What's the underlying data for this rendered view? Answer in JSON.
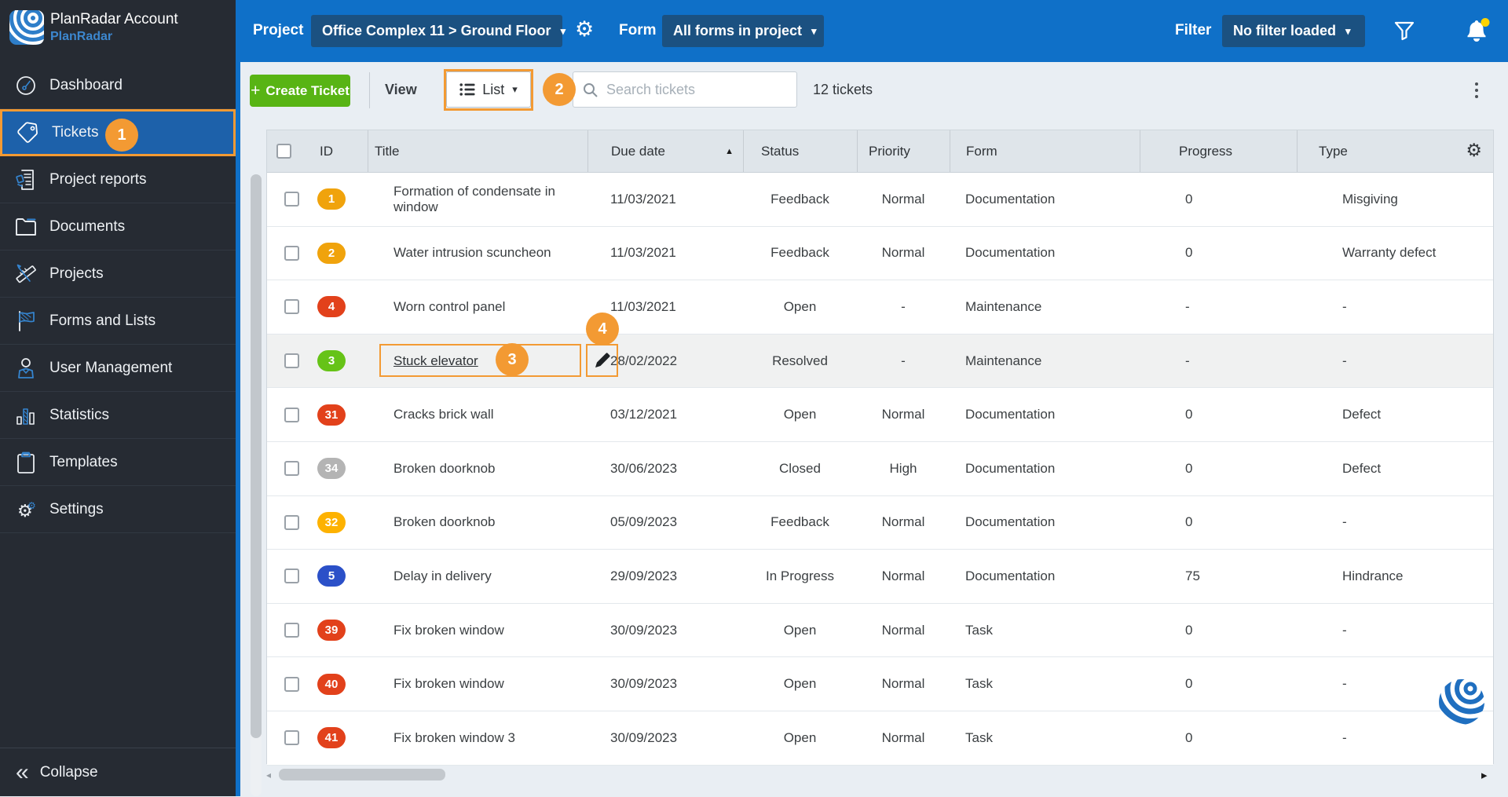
{
  "account": {
    "title": "PlanRadar Account",
    "subtitle": "PlanRadar"
  },
  "sidebar": {
    "items": [
      {
        "label": "Dashboard",
        "icon": "gauge-icon",
        "active": false
      },
      {
        "label": "Tickets",
        "icon": "tag-icon",
        "active": true,
        "annotation": "1"
      },
      {
        "label": "Project reports",
        "icon": "report-icon",
        "active": false
      },
      {
        "label": "Documents",
        "icon": "folder-icon",
        "active": false
      },
      {
        "label": "Projects",
        "icon": "ruler-pencil-icon",
        "active": false
      },
      {
        "label": "Forms and Lists",
        "icon": "flag-icon",
        "active": false
      },
      {
        "label": "User Management",
        "icon": "user-icon",
        "active": false
      },
      {
        "label": "Statistics",
        "icon": "bar-chart-icon",
        "active": false
      },
      {
        "label": "Templates",
        "icon": "clipboard-icon",
        "active": false
      },
      {
        "label": "Settings",
        "icon": "gears-icon",
        "active": false
      }
    ],
    "collapse_label": "Collapse"
  },
  "topbar": {
    "project_label": "Project",
    "project_value": "Office Complex 11 > Ground Floor",
    "form_label": "Form",
    "form_value": "All forms in project",
    "filter_label": "Filter",
    "filter_value": "No filter loaded"
  },
  "toolbar": {
    "create_plus": "+",
    "create_label": "Create Ticket",
    "view_label": "View",
    "view_mode": "List",
    "search_placeholder": "Search tickets",
    "ticket_count": "12 tickets"
  },
  "table": {
    "columns": [
      "ID",
      "Title",
      "Due date",
      "Status",
      "Priority",
      "Form",
      "Progress",
      "Type"
    ],
    "rows": [
      {
        "id": "1",
        "id_color": "#f0a30c",
        "title": "Formation of condensate in window",
        "due": "11/03/2021",
        "status": "Feedback",
        "priority": "Normal",
        "form": "Documentation",
        "progress": "0",
        "type": "Misgiving"
      },
      {
        "id": "2",
        "id_color": "#f0a30c",
        "title": "Water intrusion scuncheon",
        "due": "11/03/2021",
        "status": "Feedback",
        "priority": "Normal",
        "form": "Documentation",
        "progress": "0",
        "type": "Warranty defect"
      },
      {
        "id": "4",
        "id_color": "#e2411b",
        "title": "Worn control panel",
        "due": "11/03/2021",
        "status": "Open",
        "priority": "-",
        "form": "Maintenance",
        "progress": "-",
        "type": "-"
      },
      {
        "id": "3",
        "id_color": "#66c317",
        "title": "Stuck elevator",
        "due": "28/02/2022",
        "status": "Resolved",
        "priority": "-",
        "form": "Maintenance",
        "progress": "-",
        "type": "-",
        "highlighted": true,
        "title_link": true
      },
      {
        "id": "31",
        "id_color": "#e2411b",
        "title": "Cracks brick wall",
        "due": "03/12/2021",
        "status": "Open",
        "priority": "Normal",
        "form": "Documentation",
        "progress": "0",
        "type": "Defect"
      },
      {
        "id": "34",
        "id_color": "#b4b4b4",
        "title": "Broken doorknob",
        "due": "30/06/2023",
        "status": "Closed",
        "priority": "High",
        "form": "Documentation",
        "progress": "0",
        "type": "Defect"
      },
      {
        "id": "32",
        "id_color": "#fdb201",
        "title": "Broken doorknob",
        "due": "05/09/2023",
        "status": "Feedback",
        "priority": "Normal",
        "form": "Documentation",
        "progress": "0",
        "type": "-"
      },
      {
        "id": "5",
        "id_color": "#2b50c8",
        "title": "Delay in delivery",
        "due": "29/09/2023",
        "status": "In Progress",
        "priority": "Normal",
        "form": "Documentation",
        "progress": "75",
        "type": "Hindrance"
      },
      {
        "id": "39",
        "id_color": "#e2411b",
        "title": "Fix broken window",
        "due": "30/09/2023",
        "status": "Open",
        "priority": "Normal",
        "form": "Task",
        "progress": "0",
        "type": "-"
      },
      {
        "id": "40",
        "id_color": "#e2411b",
        "title": "Fix broken window",
        "due": "30/09/2023",
        "status": "Open",
        "priority": "Normal",
        "form": "Task",
        "progress": "0",
        "type": "-"
      },
      {
        "id": "41",
        "id_color": "#e2411b",
        "title": "Fix broken window 3",
        "due": "30/09/2023",
        "status": "Open",
        "priority": "Normal",
        "form": "Task",
        "progress": "0",
        "type": "-"
      }
    ]
  },
  "annotations": {
    "step2": "2",
    "step3": "3",
    "step4": "4"
  },
  "colors": {
    "annotation_orange": "#f39a33",
    "topbar_blue": "#0f70c8",
    "sidebar_dark": "#262b33",
    "active_item_blue": "#1d61aa",
    "create_green": "#58b414",
    "notification_dot": "#ffd400"
  }
}
